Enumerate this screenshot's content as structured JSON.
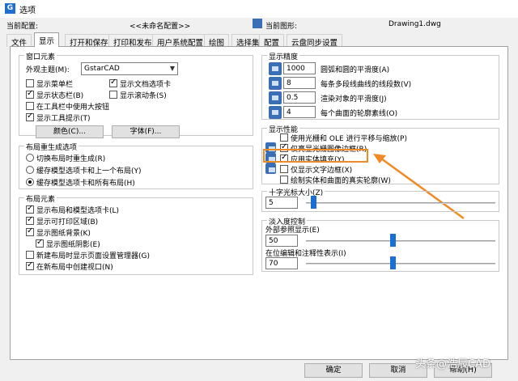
{
  "window": {
    "title": "选项"
  },
  "info": {
    "current_profile_label": "当前配置:",
    "current_profile_value": "<<未命名配置>>",
    "current_drawing_label": "当前图形:",
    "current_drawing_value": "Drawing1.dwg"
  },
  "tabs": [
    "文件",
    "显示",
    "打开和保存",
    "打印和发布",
    "用户系统配置",
    "绘图",
    "选择集",
    "配置",
    "云盘同步设置"
  ],
  "window_elements": {
    "title": "窗口元素",
    "theme_label": "外观主题(M):",
    "theme_value": "GstarCAD",
    "show_menubar": "显示菜单栏",
    "show_doc_tabs": "显示文档选项卡",
    "show_statusbar": "显示状态栏(B)",
    "show_scrollbars": "显示滚动条(S)",
    "large_buttons": "在工具栏中使用大按钮",
    "show_tooltips": "显示工具提示(T)",
    "colors_button": "颜色(C)...",
    "fonts_button": "字体(F)..."
  },
  "layout_regen": {
    "title": "布局重生成选项",
    "opt1": "切换布局时重生成(R)",
    "opt2": "缓存模型选项卡和上一个布局(Y)",
    "opt3": "缓存模型选项卡和所有布局(H)"
  },
  "layout_elements": {
    "title": "布局元素",
    "item1": "显示布局和模型选项卡(L)",
    "item2": "显示可打印区域(B)",
    "item3": "显示图纸背景(K)",
    "item4": "显示图纸阴影(E)",
    "item5": "新建布局时显示页面设置管理器(G)",
    "item6": "在新布局中创建视口(N)"
  },
  "display_resolution": {
    "title": "显示精度",
    "r1_value": "1000",
    "r1_label": "圆弧和圆的平滑度(A)",
    "r2_value": "8",
    "r2_label": "每条多段线曲线的线段数(V)",
    "r3_value": "0.5",
    "r3_label": "渲染对象的平滑度(J)",
    "r4_value": "4",
    "r4_label": "每个曲面的轮廓素线(O)"
  },
  "display_performance": {
    "title": "显示性能",
    "p1": "使用光栅和 OLE 进行平移与缩放(P)",
    "p2": "仅亮显光栅图像边框(R)",
    "p3": "应用实体填充(Y)",
    "p4": "仅显示文字边框(X)",
    "p5": "绘制实体和曲面的真实轮廓(W)"
  },
  "crosshair": {
    "title": "十字光标大小(Z)",
    "value": "5"
  },
  "fade": {
    "title": "淡入度控制",
    "xref_label": "外部参照显示(E)",
    "xref_value": "50",
    "inplace_label": "在位编辑和注释性表示(I)",
    "inplace_value": "70"
  },
  "footer": {
    "ok": "确定",
    "cancel": "取消",
    "help": "帮助(H)"
  },
  "watermark": "头条@浩辰CAD",
  "accent": "#f08a24"
}
